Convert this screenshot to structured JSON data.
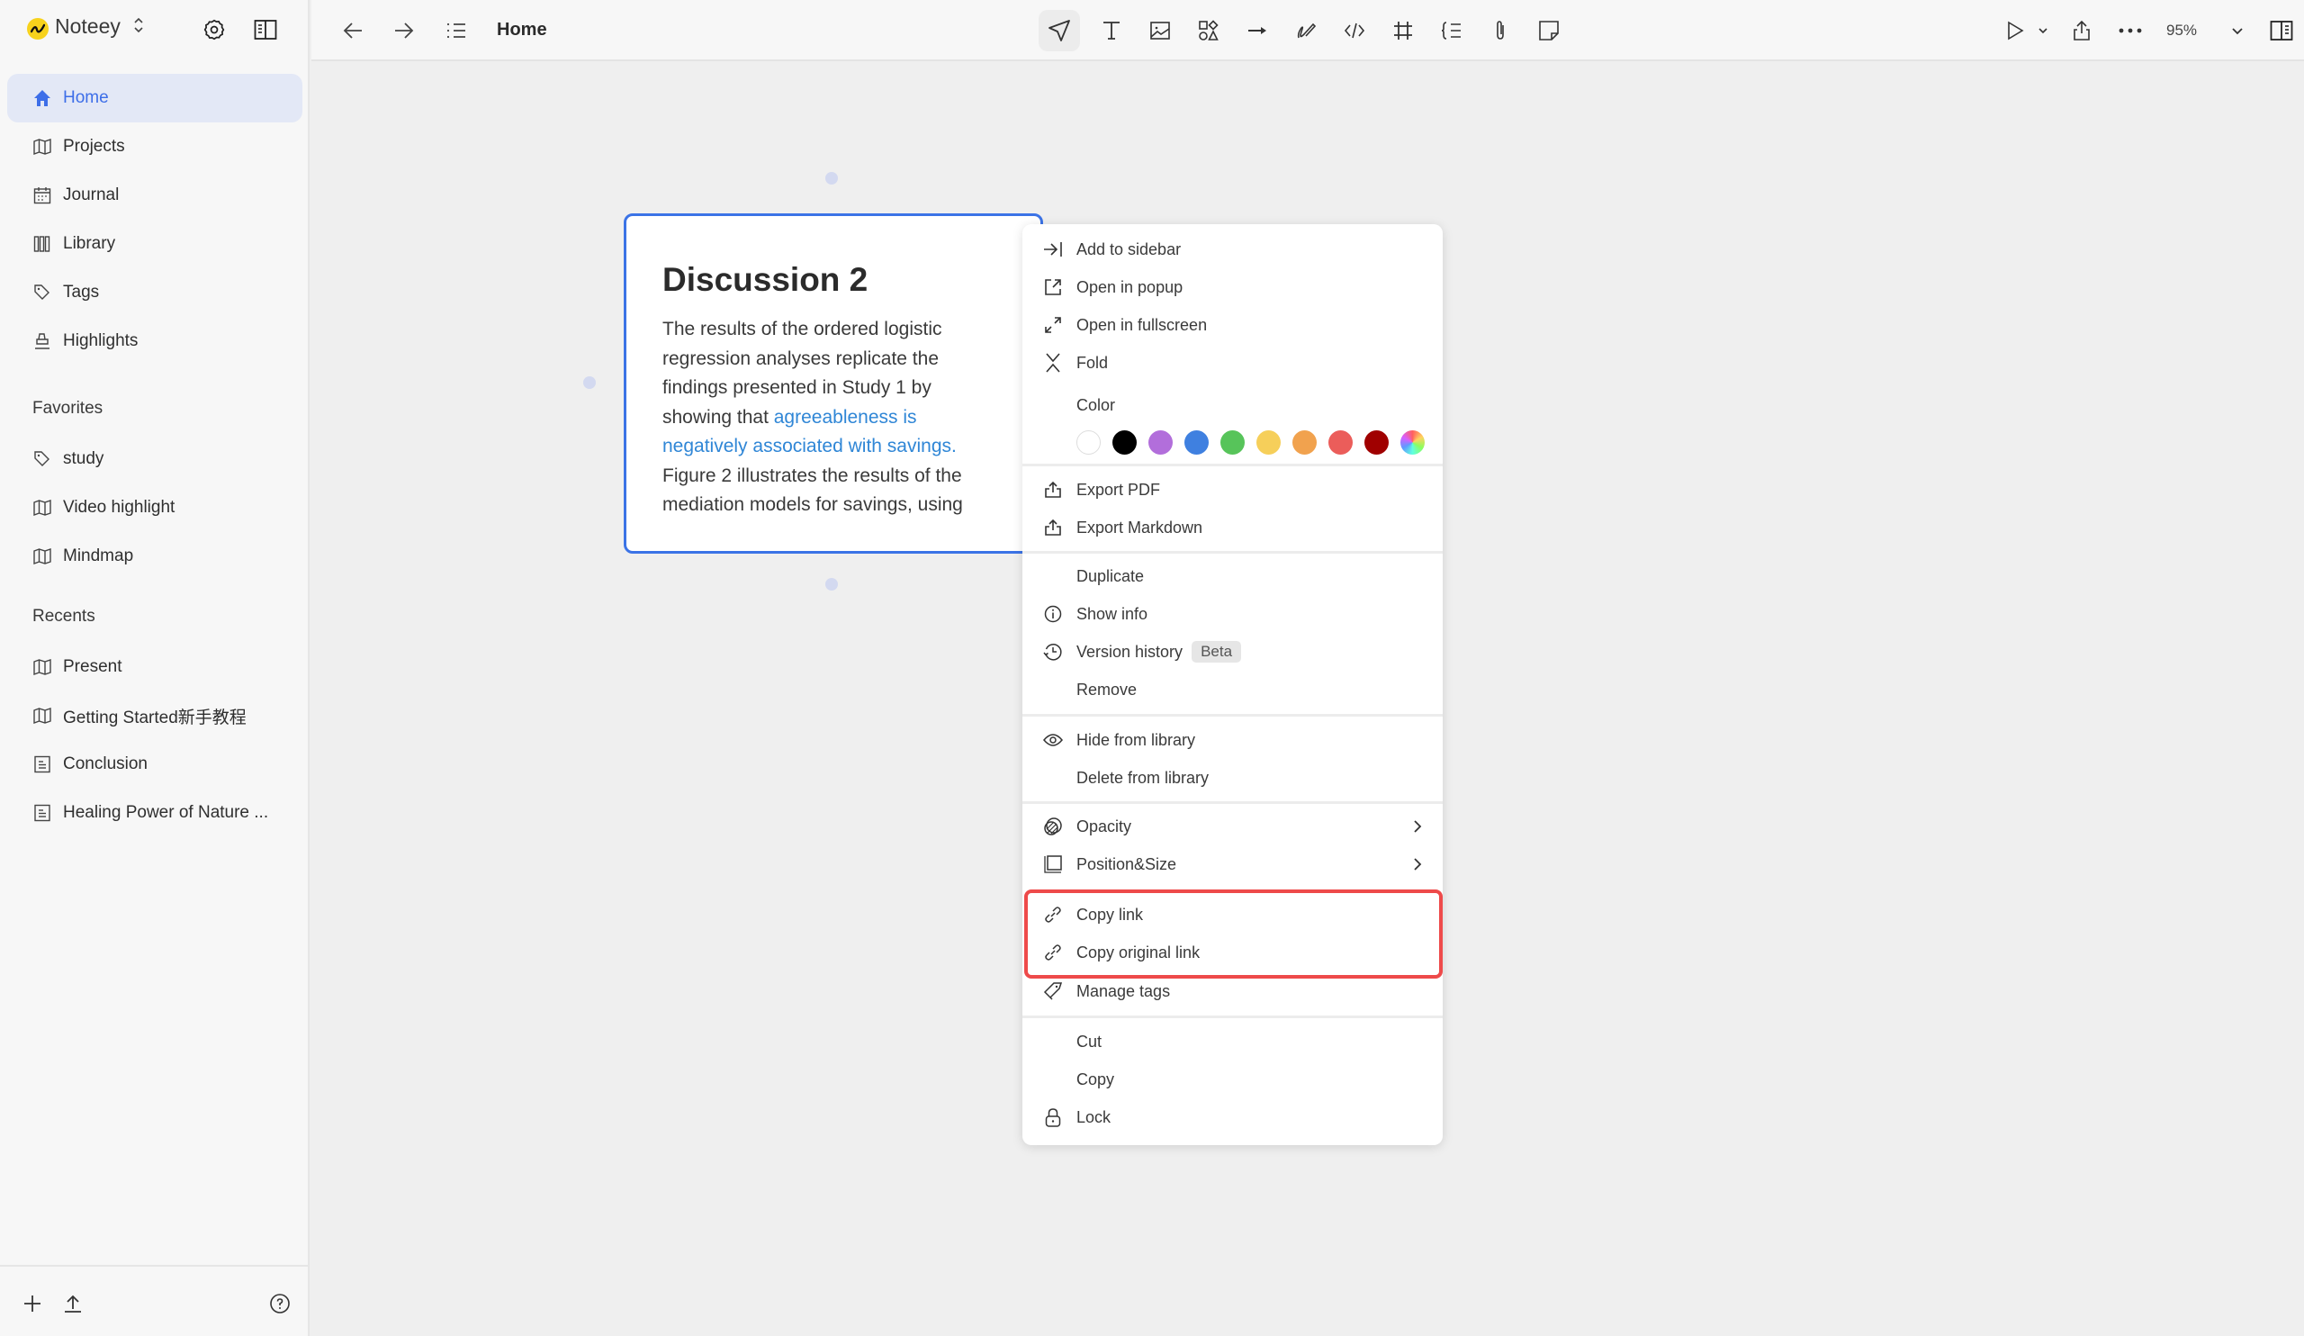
{
  "app": {
    "name": "Noteey",
    "logo_color": "#f7d21c",
    "accent_color": "#3d6ee8"
  },
  "sidebar": {
    "nav": [
      {
        "label": "Home",
        "icon": "home-icon",
        "active": true
      },
      {
        "label": "Projects",
        "icon": "map-icon"
      },
      {
        "label": "Journal",
        "icon": "calendar-icon"
      },
      {
        "label": "Library",
        "icon": "library-icon"
      },
      {
        "label": "Tags",
        "icon": "tag-icon"
      },
      {
        "label": "Highlights",
        "icon": "highlighter-icon"
      }
    ],
    "favorites_label": "Favorites",
    "favorites": [
      {
        "label": "study",
        "icon": "tag-icon"
      },
      {
        "label": "Video highlight",
        "icon": "map-icon"
      },
      {
        "label": "Mindmap",
        "icon": "map-icon"
      }
    ],
    "recents_label": "Recents",
    "recents": [
      {
        "label": "Present",
        "icon": "map-icon"
      },
      {
        "label": "Getting Started新手教程",
        "icon": "map-icon"
      },
      {
        "label": "Conclusion",
        "icon": "document-icon"
      },
      {
        "label": "Healing Power of Nature ...",
        "icon": "document-icon"
      }
    ]
  },
  "header": {
    "title": "Home",
    "zoom": "95%",
    "tools": [
      "select",
      "text",
      "image",
      "shapes",
      "arrow",
      "pen",
      "code",
      "frame",
      "outline",
      "attachment",
      "sticky-note"
    ]
  },
  "card": {
    "title": "Discussion 2",
    "body_before": "The results of the ordered logistic regression analyses replicate the findings presented in Study 1 by showing that ",
    "body_highlight": "agreeableness is negatively associated with savings.",
    "body_after": " Figure 2 illustrates the results of the mediation models for savings, using",
    "border_color": "#3b73e6",
    "highlight_color": "#2f86d6"
  },
  "context_menu": {
    "group1": [
      {
        "label": "Add to sidebar",
        "icon": "add-to-sidebar-icon"
      },
      {
        "label": "Open in popup",
        "icon": "open-popup-icon"
      },
      {
        "label": "Open in fullscreen",
        "icon": "fullscreen-icon"
      },
      {
        "label": "Fold",
        "icon": "fold-icon"
      }
    ],
    "color_label": "Color",
    "colors": [
      "#ffffff",
      "#000000",
      "#b26edb",
      "#3f80e0",
      "#57c45a",
      "#f6cf5a",
      "#f1a24e",
      "#eb5d5a",
      "#a00000",
      "rainbow"
    ],
    "export": [
      {
        "label": "Export PDF",
        "icon": "export-icon"
      },
      {
        "label": "Export Markdown",
        "icon": "export-icon"
      }
    ],
    "manage": [
      {
        "label": "Duplicate",
        "icon": ""
      },
      {
        "label": "Show info",
        "icon": "info-icon"
      },
      {
        "label": "Version history",
        "icon": "history-icon",
        "badge": "Beta"
      },
      {
        "label": "Remove",
        "icon": ""
      }
    ],
    "library": [
      {
        "label": "Hide from library",
        "icon": "eye-icon"
      },
      {
        "label": "Delete from library",
        "icon": ""
      }
    ],
    "props": [
      {
        "label": "Opacity",
        "icon": "opacity-icon",
        "submenu": true
      },
      {
        "label": "Position&Size",
        "icon": "position-size-icon",
        "submenu": true
      },
      {
        "label": "Copy link",
        "icon": "link-icon"
      },
      {
        "label": "Copy original link",
        "icon": "link-icon"
      },
      {
        "label": "Manage tags",
        "icon": "tag-icon"
      }
    ],
    "clipboard": [
      {
        "label": "Cut",
        "icon": ""
      },
      {
        "label": "Copy",
        "icon": ""
      },
      {
        "label": "Lock",
        "icon": "lock-icon"
      }
    ],
    "highlight_border_color": "#ee4a4a"
  }
}
